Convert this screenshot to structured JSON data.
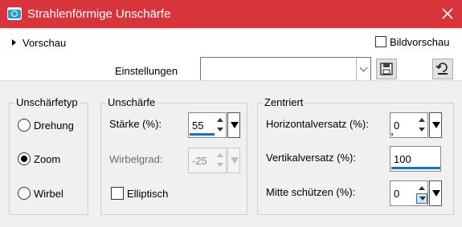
{
  "window": {
    "title": "Strahlenförmige Unschärfe",
    "title_icon": "camera-icon",
    "close_icon": "close-icon",
    "accent_color": "#d8343c"
  },
  "top": {
    "preview_label": "Vorschau",
    "bild_preview_label": "Bildvorschau",
    "bild_preview_checked": false,
    "settings_label": "Einstellungen",
    "settings_value": "",
    "save_icon": "floppy-disk-icon",
    "reset_icon": "reset-icon"
  },
  "blur_type": {
    "legend": "Unschärfetyp",
    "options": [
      "Drehung",
      "Zoom",
      "Wirbel"
    ],
    "selected": "Zoom"
  },
  "blur": {
    "legend": "Unschärfe",
    "strength_label": "Stärke (%):",
    "strength_value": "55",
    "swirl_label": "Wirbelgrad:",
    "swirl_value": "-25",
    "swirl_enabled": false,
    "elliptic_label": "Elliptisch",
    "elliptic_checked": false
  },
  "centered": {
    "legend": "Zentriert",
    "h_offset_label": "Horizontalversatz (%):",
    "h_offset_value": "0",
    "v_offset_label": "Vertikalversatz (%):",
    "v_offset_value": "100",
    "protect_center_label": "Mitte schützen (%):",
    "protect_center_value": "0"
  }
}
